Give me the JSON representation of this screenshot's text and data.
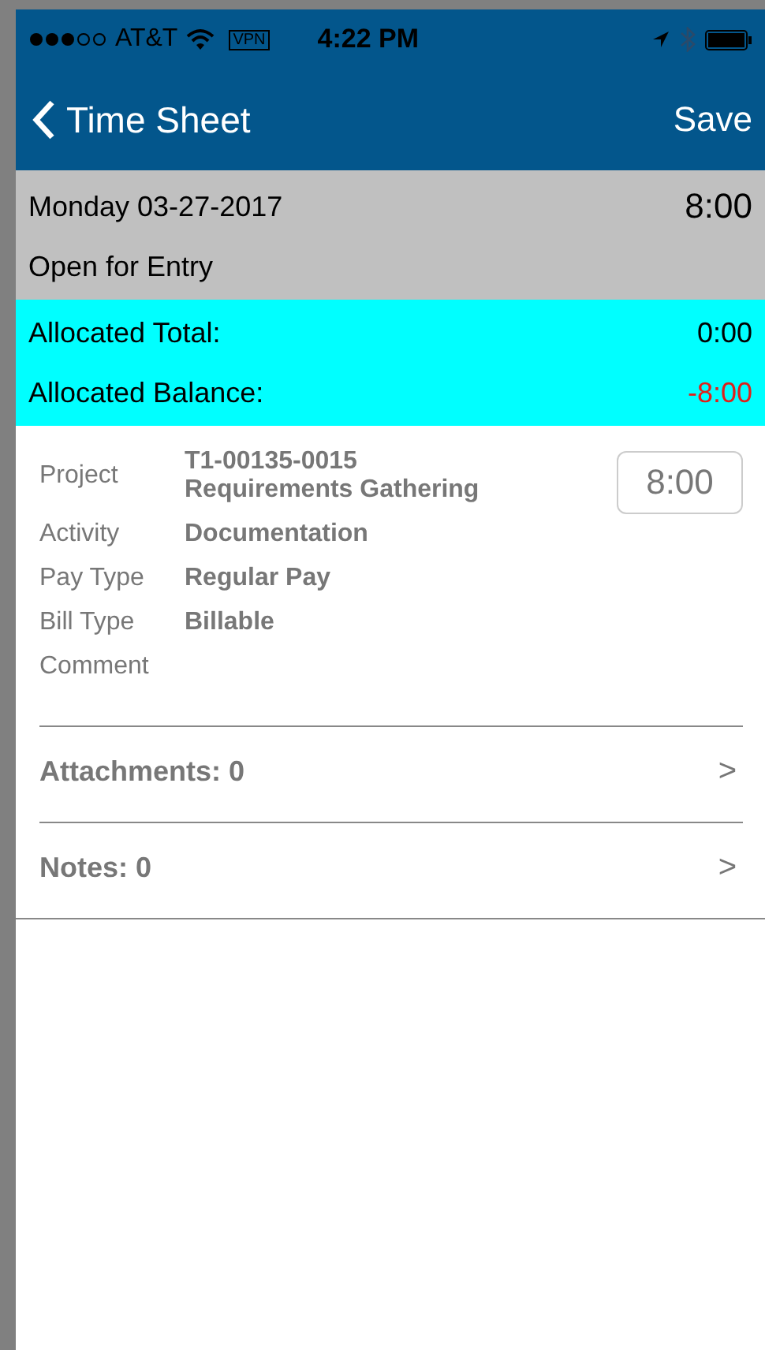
{
  "status_bar": {
    "carrier": "AT&T",
    "vpn": "VPN",
    "time": "4:22 PM"
  },
  "nav": {
    "back_label": "Time Sheet",
    "action": "Save"
  },
  "day": {
    "date": "Monday 03-27-2017",
    "hours": "8:00",
    "status": "Open for Entry"
  },
  "allocation": [
    {
      "label": "Allocated Total:",
      "value": "0:00",
      "negative": false
    },
    {
      "label": "Allocated Balance:",
      "value": "-8:00",
      "negative": true
    }
  ],
  "entry": {
    "hours": "8:00",
    "fields": [
      {
        "label": "Project",
        "lines": [
          "T1-00135-0015",
          "Requirements Gathering"
        ]
      },
      {
        "label": "Activity",
        "lines": [
          "Documentation"
        ]
      },
      {
        "label": "Pay Type",
        "lines": [
          "Regular Pay"
        ]
      },
      {
        "label": "Bill Type",
        "lines": [
          "Billable"
        ]
      },
      {
        "label": "Comment"
      }
    ]
  },
  "links": [
    {
      "label": "Attachments: 0",
      "chevron": ">"
    },
    {
      "label": "Notes: 0",
      "chevron": ">"
    }
  ]
}
